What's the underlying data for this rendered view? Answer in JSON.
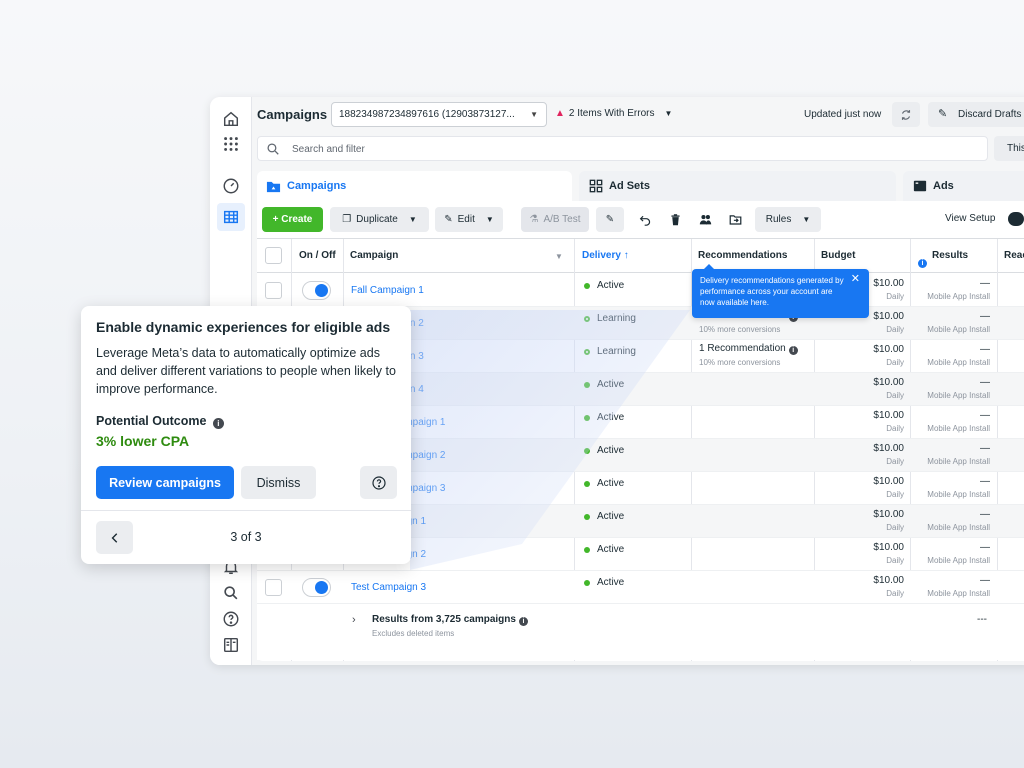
{
  "topbar": {
    "title": "Campaigns",
    "account": "188234987234897616 (12903873127...",
    "errors": "2 Items With Errors",
    "updated": "Updated just now",
    "discard": "Discard Drafts"
  },
  "search": {
    "placeholder": "Search and filter",
    "this_label": "This"
  },
  "tabs": {
    "campaigns": "Campaigns",
    "ad_sets": "Ad Sets",
    "ads": "Ads"
  },
  "toolbar": {
    "create": "+ Create",
    "duplicate": "Duplicate",
    "edit": "Edit",
    "ab_test": "A/B Test",
    "rules": "Rules",
    "view_setup": "View Setup"
  },
  "table": {
    "headers": {
      "on_off": "On / Off",
      "campaign": "Campaign",
      "delivery": "Delivery ↑",
      "recommendations": "Recommendations",
      "budget": "Budget",
      "results": "Results",
      "reach": "Reac"
    },
    "rows": [
      {
        "name": "Fall Campaign 1",
        "delivery": "Active",
        "learning": false,
        "rec": "",
        "rec_sub": "",
        "budget": "$10.00",
        "budget_sub": "Daily",
        "results": "—",
        "results_sub": "Mobile App Install"
      },
      {
        "name": "Fall Campaign 2",
        "delivery": "Learning",
        "learning": true,
        "rec": "1 Recommendation",
        "rec_sub": "10% more conversions",
        "budget": "$10.00",
        "budget_sub": "Daily",
        "results": "—",
        "results_sub": "Mobile App Install"
      },
      {
        "name": "Fall Campaign 3",
        "delivery": "Learning",
        "learning": true,
        "rec": "1 Recommendation",
        "rec_sub": "10% more conversions",
        "budget": "$10.00",
        "budget_sub": "Daily",
        "results": "—",
        "results_sub": "Mobile App Install"
      },
      {
        "name": "Fall Campaign 4",
        "delivery": "Active",
        "learning": false,
        "rec": "",
        "rec_sub": "",
        "budget": "$10.00",
        "budget_sub": "Daily",
        "results": "—",
        "results_sub": "Mobile App Install"
      },
      {
        "name": "Summer Campaign 1",
        "delivery": "Active",
        "learning": false,
        "rec": "",
        "rec_sub": "",
        "budget": "$10.00",
        "budget_sub": "Daily",
        "results": "—",
        "results_sub": "Mobile App Install"
      },
      {
        "name": "Summer Campaign 2",
        "delivery": "Active",
        "learning": false,
        "rec": "",
        "rec_sub": "",
        "budget": "$10.00",
        "budget_sub": "Daily",
        "results": "—",
        "results_sub": "Mobile App Install"
      },
      {
        "name": "Summer Campaign 3",
        "delivery": "Active",
        "learning": false,
        "rec": "",
        "rec_sub": "",
        "budget": "$10.00",
        "budget_sub": "Daily",
        "results": "—",
        "results_sub": "Mobile App Install"
      },
      {
        "name": "Test Campaign 1",
        "delivery": "Active",
        "learning": false,
        "rec": "",
        "rec_sub": "",
        "budget": "$10.00",
        "budget_sub": "Daily",
        "results": "—",
        "results_sub": "Mobile App Install"
      },
      {
        "name": "Test Campaign 2",
        "delivery": "Active",
        "learning": false,
        "rec": "",
        "rec_sub": "",
        "budget": "$10.00",
        "budget_sub": "Daily",
        "results": "—",
        "results_sub": "Mobile App Install"
      },
      {
        "name": "Test Campaign 3",
        "delivery": "Active",
        "learning": false,
        "rec": "",
        "rec_sub": "",
        "budget": "$10.00",
        "budget_sub": "Daily",
        "results": "—",
        "results_sub": "Mobile App Install"
      }
    ],
    "summary": {
      "title": "Results from 3,725 campaigns",
      "sub": "Excludes deleted items",
      "dash": "---"
    }
  },
  "tooltip": {
    "text": "Delivery recommendations generated by performance across your account are now available here."
  },
  "card": {
    "title": "Enable dynamic experiences for eligible ads",
    "body": "Leverage Meta’s data to automatically optimize ads and deliver different variations to people when likely to improve performance.",
    "outcome_label": "Potential Outcome",
    "outcome_value": "3% lower CPA",
    "review": "Review campaigns",
    "dismiss": "Dismiss",
    "pager": "3 of 3"
  },
  "colors": {
    "accent": "#1877f2",
    "create": "#42b72a",
    "positive": "#2e8b0f"
  }
}
